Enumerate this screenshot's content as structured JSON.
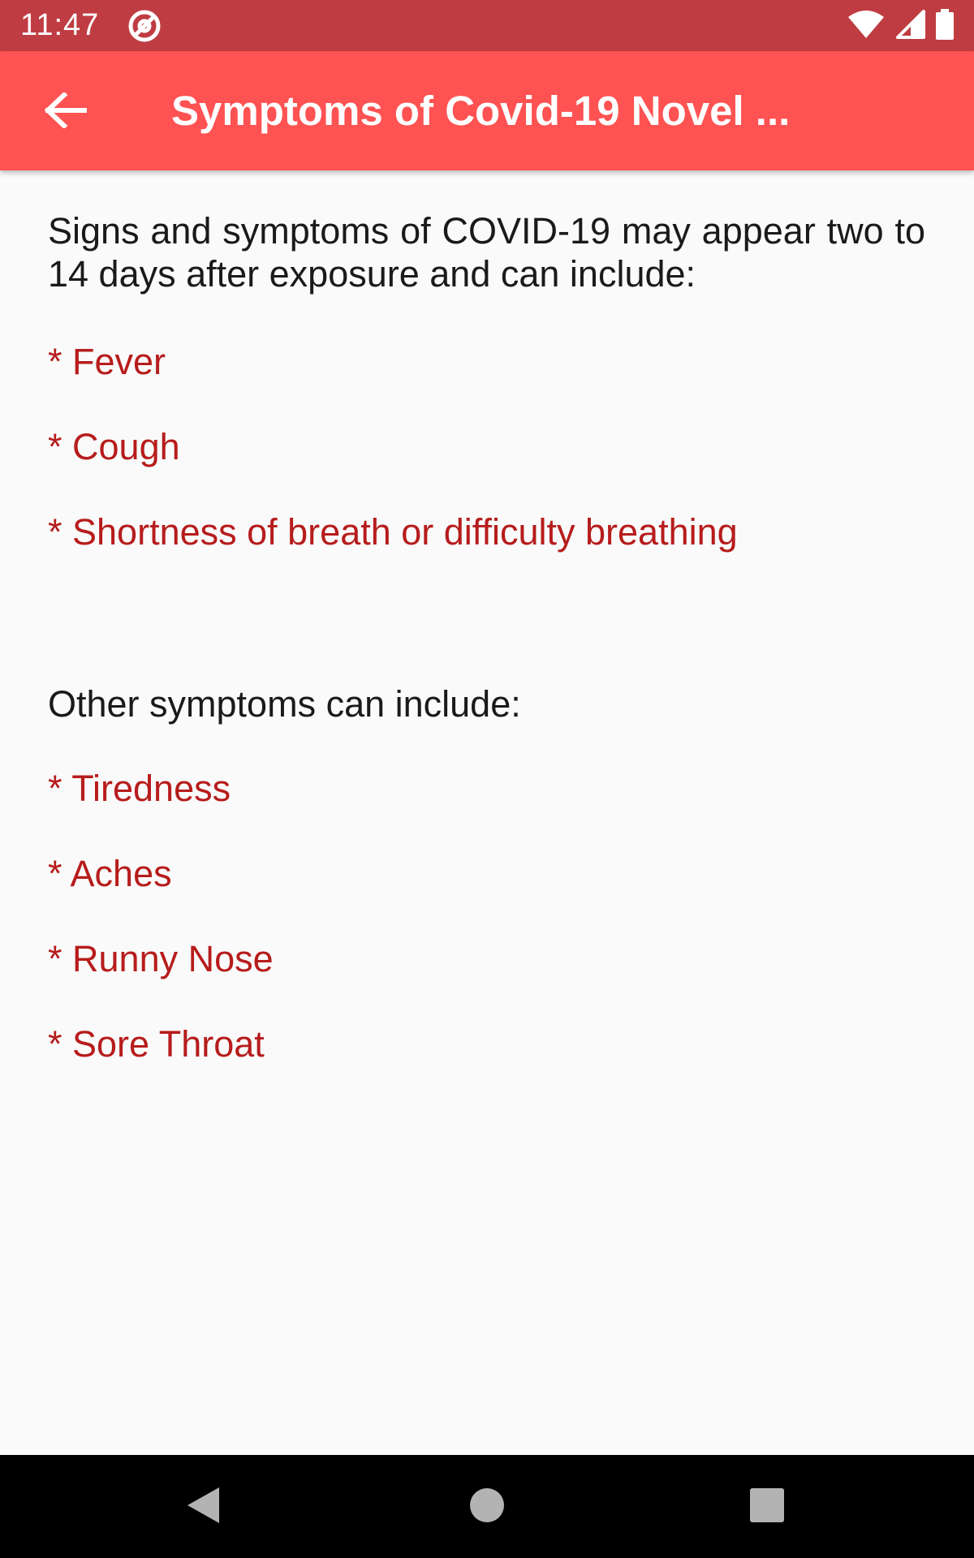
{
  "status_bar": {
    "time": "11:47"
  },
  "app_bar": {
    "title": "Symptoms of Covid-19 Novel ..."
  },
  "content": {
    "intro": "Signs and symptoms of COVID-19 may appear two to 14 days after exposure and can include:",
    "primary_symptoms": [
      "* Fever",
      "* Cough",
      "* Shortness of breath or difficulty breathing"
    ],
    "other_heading": "Other symptoms can include:",
    "other_symptoms": [
      "* Tiredness",
      "* Aches",
      "* Runny Nose",
      "* Sore Throat"
    ]
  },
  "colors": {
    "status_bar": "#bf3d42",
    "app_bar": "#ff5252",
    "symptom_text": "#b71c1c",
    "background": "#fafafa"
  },
  "icons": {
    "back": "arrow-left-icon",
    "status_app": "at-sign-icon",
    "wifi": "wifi-icon",
    "signal": "cell-signal-icon",
    "battery": "battery-icon",
    "nav_back": "triangle-back-icon",
    "nav_home": "circle-home-icon",
    "nav_recents": "square-recents-icon"
  }
}
